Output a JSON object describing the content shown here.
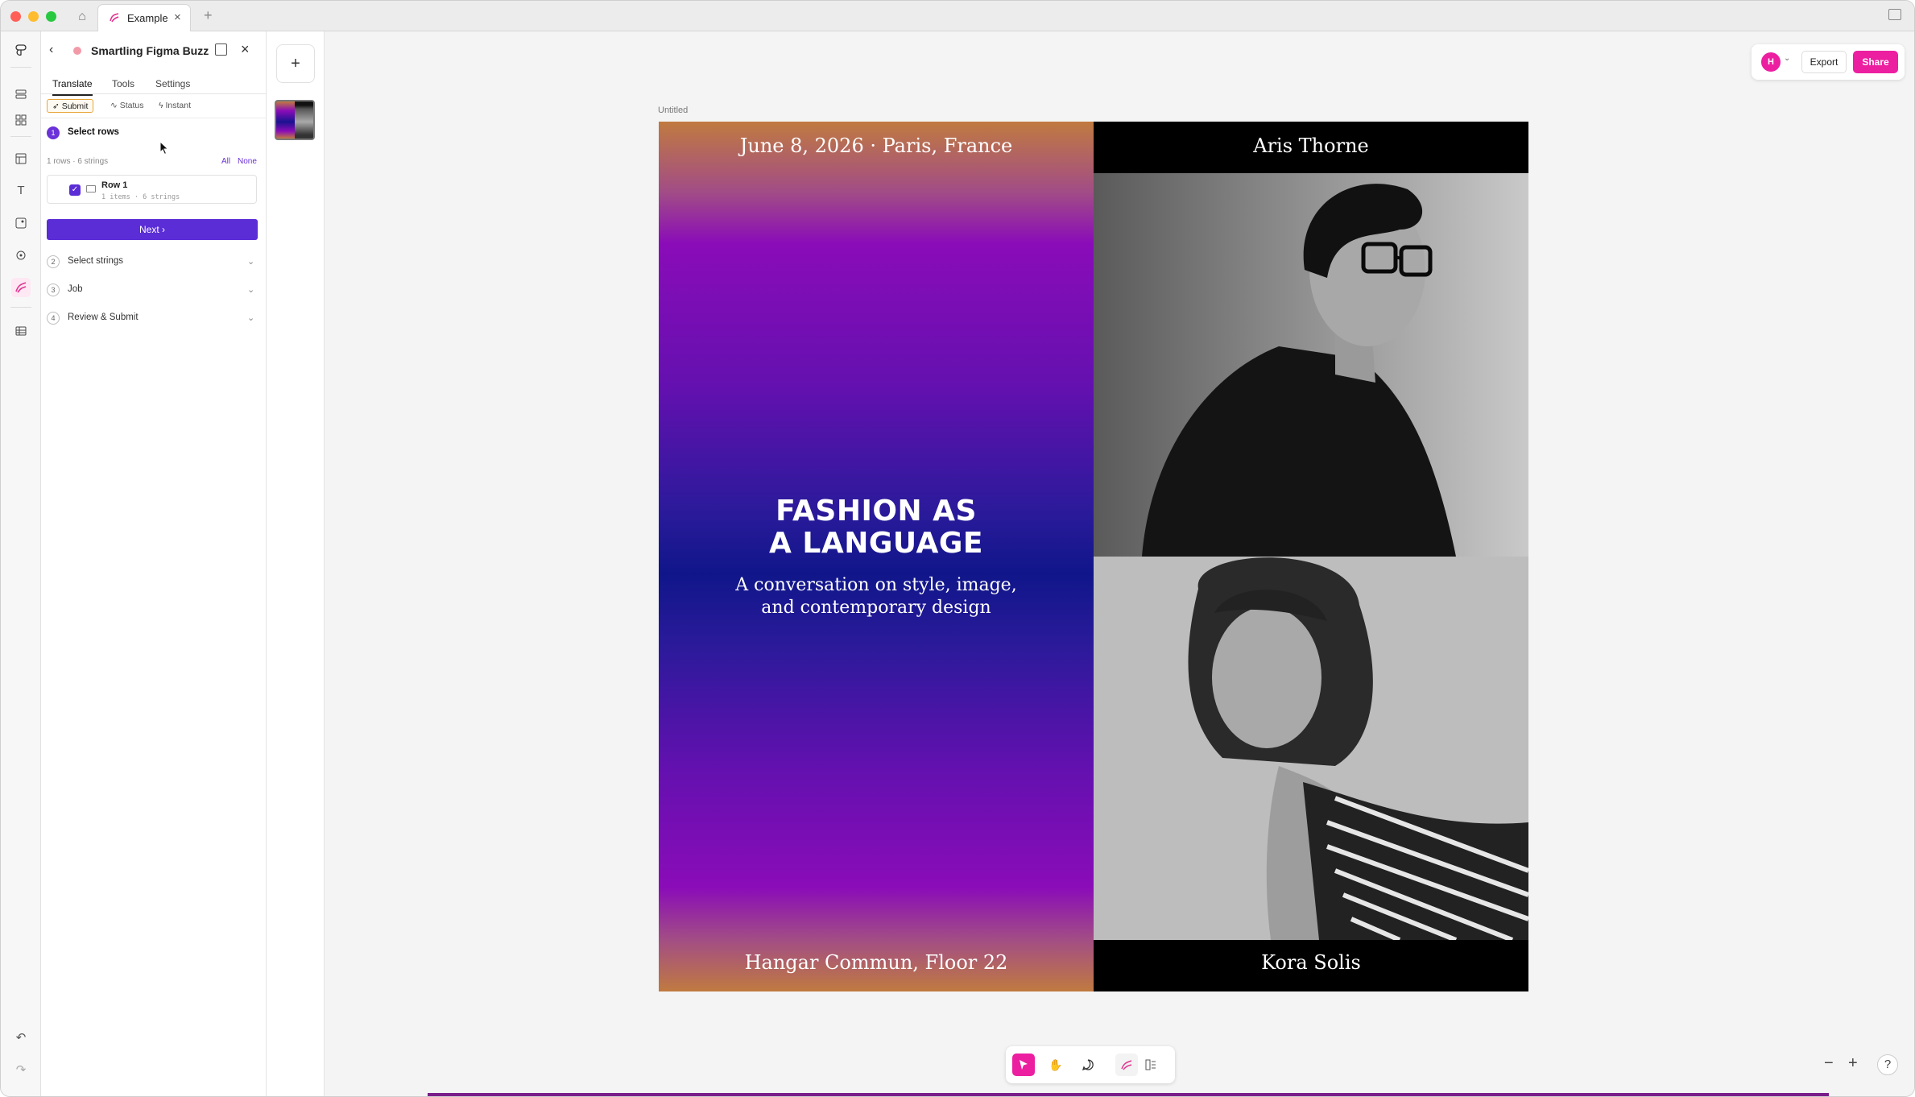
{
  "browser": {
    "tab_label": "Example"
  },
  "plugin": {
    "title": "Smartling Figma Buzz",
    "tabs": [
      "Translate",
      "Tools",
      "Settings"
    ],
    "modes": [
      "Submit",
      "Status",
      "Instant"
    ],
    "steps": [
      {
        "num": "1",
        "label": "Select rows"
      },
      {
        "num": "2",
        "label": "Select strings"
      },
      {
        "num": "3",
        "label": "Job"
      },
      {
        "num": "4",
        "label": "Review & Submit"
      }
    ],
    "rows_meta": "1 rows · 6 strings",
    "all_label": "All",
    "none_label": "None",
    "row": {
      "name": "Row 1",
      "sub": "1 items · 6 strings",
      "checked": true
    },
    "next_label": "Next"
  },
  "canvas": {
    "frame_label": "Untitled",
    "design": {
      "date": "June 8, 2026 · Paris, France",
      "headline_1": "FASHION AS",
      "headline_2": "A LANGUAGE",
      "sub_1": "A conversation on style, image,",
      "sub_2": "and contemporary design",
      "venue": "Hangar Commun, Floor 22",
      "name_top": "Aris Thorne",
      "name_bottom": "Kora Solis"
    }
  },
  "topbar": {
    "avatar_initial": "H",
    "export_label": "Export",
    "share_label": "Share"
  },
  "colors": {
    "accent": "#ec1fa0",
    "plugin_purple": "#5b2dd6",
    "mode_highlight": "#e8a53a"
  },
  "icons": [
    "home-icon",
    "figma-icon",
    "layers-icon",
    "assets-icon",
    "layout-icon",
    "text-icon",
    "image-icon",
    "component-icon",
    "plugin-icon",
    "table-icon",
    "undo-icon",
    "redo-icon",
    "move-icon",
    "hand-icon",
    "comment-icon",
    "plugin-tool-icon",
    "widget-icon"
  ]
}
